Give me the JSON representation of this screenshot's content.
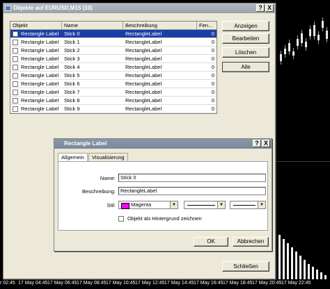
{
  "objects_window": {
    "title": "Objekte auf EURUSD,M15 (10)",
    "columns": [
      "Objekt",
      "Name",
      "Beschreibung",
      "Fen..."
    ],
    "rows": [
      {
        "object": "Rectangle Label",
        "name": "Stick 0",
        "description": "RectangleLabel",
        "window": "0"
      },
      {
        "object": "Rectangle Label",
        "name": "Stick 1",
        "description": "RectangleLabel",
        "window": "0"
      },
      {
        "object": "Rectangle Label",
        "name": "Stick 2",
        "description": "RectangleLabel",
        "window": "0"
      },
      {
        "object": "Rectangle Label",
        "name": "Stick 3",
        "description": "RectangleLabel",
        "window": "0"
      },
      {
        "object": "Rectangle Label",
        "name": "Stick 4",
        "description": "RectangleLabel",
        "window": "0"
      },
      {
        "object": "Rectangle Label",
        "name": "Stick 5",
        "description": "RectangleLabel",
        "window": "0"
      },
      {
        "object": "Rectangle Label",
        "name": "Stick 6",
        "description": "RectangleLabel",
        "window": "0"
      },
      {
        "object": "Rectangle Label",
        "name": "Stick 7",
        "description": "RectangleLabel",
        "window": "0"
      },
      {
        "object": "Rectangle Label",
        "name": "Stick 8",
        "description": "RectangleLabel",
        "window": "0"
      },
      {
        "object": "Rectangle Label",
        "name": "Stick 9",
        "description": "RectangleLabel",
        "window": "0"
      }
    ],
    "buttons": {
      "show": "Anzeigen",
      "edit": "Bearbeiten",
      "delete": "Löschen",
      "all": "Alle",
      "close": "Schließen"
    },
    "help_glyph": "?",
    "close_glyph": "X"
  },
  "property_dialog": {
    "title": "Rectangle Label",
    "tabs": [
      "Allgemein",
      "Visualisierung"
    ],
    "name_label": "Name:",
    "name_value": "Stick 0",
    "description_label": "Beschreibung:",
    "description_value": "RectangleLabel",
    "style_label": "Stil:",
    "color_name": "Magenta",
    "color_hex": "#ff00ff",
    "background_checkbox": "Objekt als Hintergrund zeichnen",
    "ok": "OK",
    "cancel": "Abbrechen",
    "help_glyph": "?",
    "close_glyph": "X"
  },
  "time_axis": [
    "r 02:45",
    "17 May 04:45",
    "17 May 06:45",
    "17 May 08:45",
    "17 May 10:45",
    "17 May 12:45",
    "17 May 14:45",
    "17 May 16:45",
    "17 May 18:45",
    "17 May 20:45",
    "17 May 22:45"
  ],
  "theme": {
    "selection": "#1c3fa6",
    "background": "#000000"
  }
}
